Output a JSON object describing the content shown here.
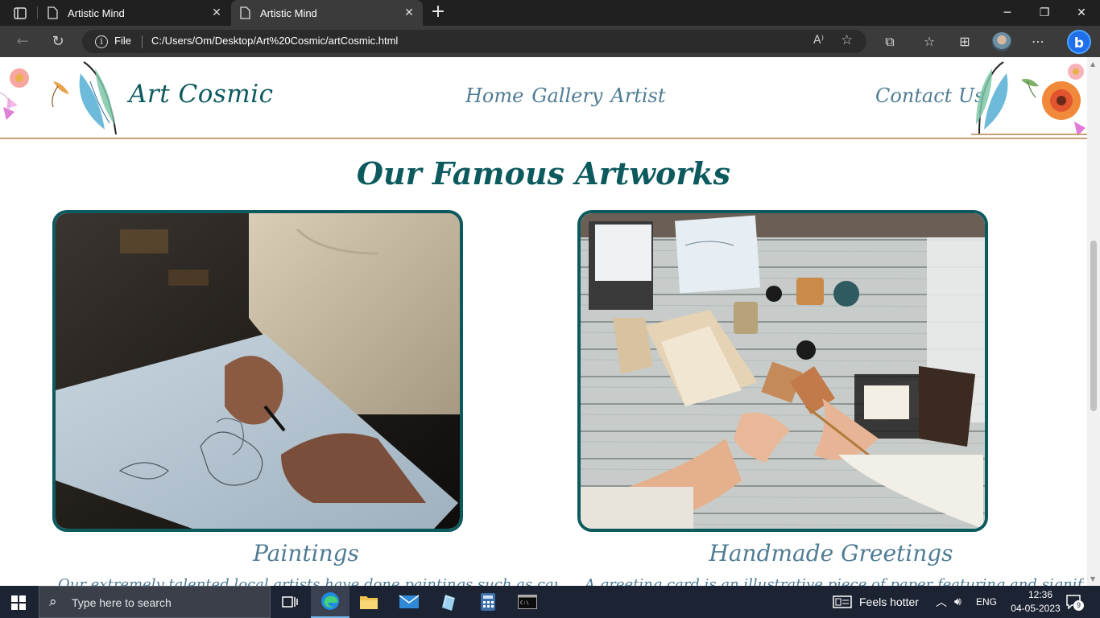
{
  "browser": {
    "tabs": [
      {
        "title": "Artistic Mind",
        "active": false
      },
      {
        "title": "Artistic Mind",
        "active": true
      }
    ],
    "address": {
      "scheme_label": "File",
      "url": "C:/Users/Om/Desktop/Art%20Cosmic/artCosmic.html"
    }
  },
  "site": {
    "brand": "Art Cosmic",
    "nav": [
      "Home",
      "Gallery",
      "Artist"
    ],
    "contact": "Contact Us",
    "section_title": "Our Famous Artworks",
    "cards": [
      {
        "title": "Paintings",
        "text": "Our extremely talented local artists have done paintings such as canvas"
      },
      {
        "title": "Handmade Greetings",
        "text": "A greeting card is an illustrative piece of paper featuring and signifying"
      }
    ]
  },
  "taskbar": {
    "search_placeholder": "Type here to search",
    "weather": "Feels hotter",
    "language": "ENG",
    "time": "12:36",
    "date": "04-05-2023",
    "notifications": "9"
  },
  "colors": {
    "brand": "#0c5a5e",
    "nav": "#4f7c94",
    "header_rule": "#c8a07a"
  }
}
